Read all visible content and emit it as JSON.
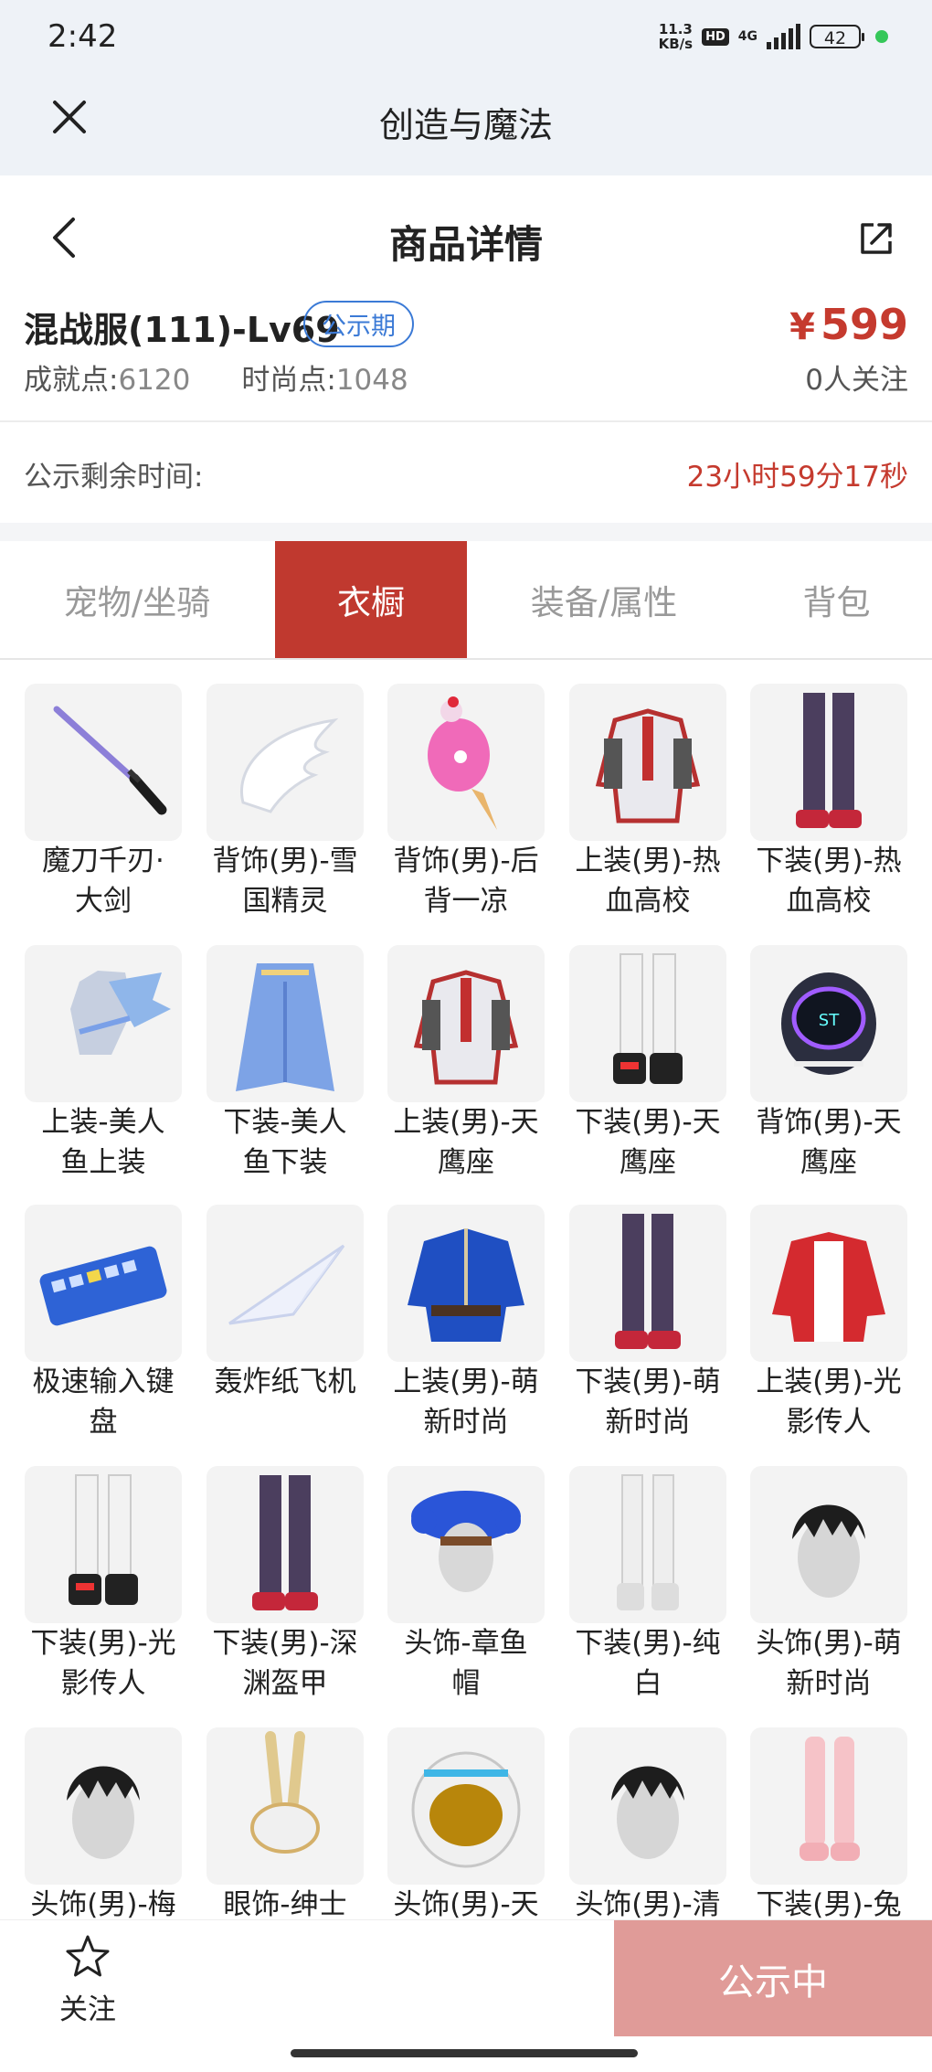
{
  "status_bar": {
    "time": "2:42",
    "net_speed_value": "11.3",
    "net_speed_unit": "KB/s",
    "hd": "HD",
    "network": "4G",
    "battery": "42"
  },
  "app": {
    "title": "创造与魔法"
  },
  "nav": {
    "title": "商品详情"
  },
  "product": {
    "name": "混战服(111)-Lv69",
    "badge": "公示期",
    "price_currency": "¥",
    "price_value": "599",
    "achievement_label": "成就点:",
    "achievement_value": "6120",
    "fashion_label": "时尚点:",
    "fashion_value": "1048",
    "followers": "0人关注"
  },
  "countdown": {
    "label": "公示剩余时间:",
    "value": "23小时59分17秒"
  },
  "tabs": [
    {
      "label": "宠物/坐骑",
      "active": false
    },
    {
      "label": "衣橱",
      "active": true
    },
    {
      "label": "装备/属性",
      "active": false
    },
    {
      "label": "背包",
      "active": false
    }
  ],
  "items": [
    {
      "line1": "魔刀千刃·",
      "line2": "大剑",
      "icon": "sword-icon"
    },
    {
      "line1": "背饰(男)-雪",
      "line2": "国精灵",
      "icon": "wings-icon"
    },
    {
      "line1": "背饰(男)-后",
      "line2": "背一凉",
      "icon": "ice-cream-icon"
    },
    {
      "line1": "上装(男)-热",
      "line2": "血高校",
      "icon": "jacket-icon"
    },
    {
      "line1": "下装(男)-热",
      "line2": "血高校",
      "icon": "pants-icon"
    },
    {
      "line1": "上装-美人",
      "line2": "鱼上装",
      "icon": "mermaid-top-icon"
    },
    {
      "line1": "下装-美人",
      "line2": "鱼下装",
      "icon": "mermaid-skirt-icon"
    },
    {
      "line1": "上装(男)-天",
      "line2": "鹰座",
      "icon": "jacket-icon"
    },
    {
      "line1": "下装(男)-天",
      "line2": "鹰座",
      "icon": "boots-icon"
    },
    {
      "line1": "背饰(男)-天",
      "line2": "鹰座",
      "icon": "robot-backpack-icon"
    },
    {
      "line1": "极速输入键",
      "line2": "盘",
      "icon": "keyboard-icon"
    },
    {
      "line1": "轰炸纸飞机",
      "line2": "",
      "icon": "paper-plane-icon"
    },
    {
      "line1": "上装(男)-萌",
      "line2": "新时尚",
      "icon": "robe-icon"
    },
    {
      "line1": "下装(男)-萌",
      "line2": "新时尚",
      "icon": "pants-icon"
    },
    {
      "line1": "上装(男)-光",
      "line2": "影传人",
      "icon": "hoodie-icon"
    },
    {
      "line1": "下装(男)-光",
      "line2": "影传人",
      "icon": "boots-icon"
    },
    {
      "line1": "下装(男)-深",
      "line2": "渊盔甲",
      "icon": "pants-icon"
    },
    {
      "line1": "头饰-章鱼",
      "line2": "帽",
      "icon": "octopus-hat-icon"
    },
    {
      "line1": "下装(男)-纯",
      "line2": "白",
      "icon": "white-pants-icon"
    },
    {
      "line1": "头饰(男)-萌",
      "line2": "新时尚",
      "icon": "hair-icon"
    },
    {
      "line1": "头饰(男)-梅",
      "line2": "",
      "icon": "hair-icon"
    },
    {
      "line1": "眼饰-绅士",
      "line2": "",
      "icon": "rabbit-mask-icon"
    },
    {
      "line1": "头饰(男)-天",
      "line2": "",
      "icon": "helmet-icon"
    },
    {
      "line1": "头饰(男)-清",
      "line2": "",
      "icon": "hair-icon"
    },
    {
      "line1": "下装(男)-兔",
      "line2": "",
      "icon": "pink-boots-icon"
    }
  ],
  "bottom_bar": {
    "follow_label": "关注",
    "status_label": "公示中"
  },
  "colors": {
    "accent_red": "#c0392f",
    "price_red": "#c53a2e",
    "badge_blue": "#3b7ad6",
    "status_button": "#e09b98"
  }
}
